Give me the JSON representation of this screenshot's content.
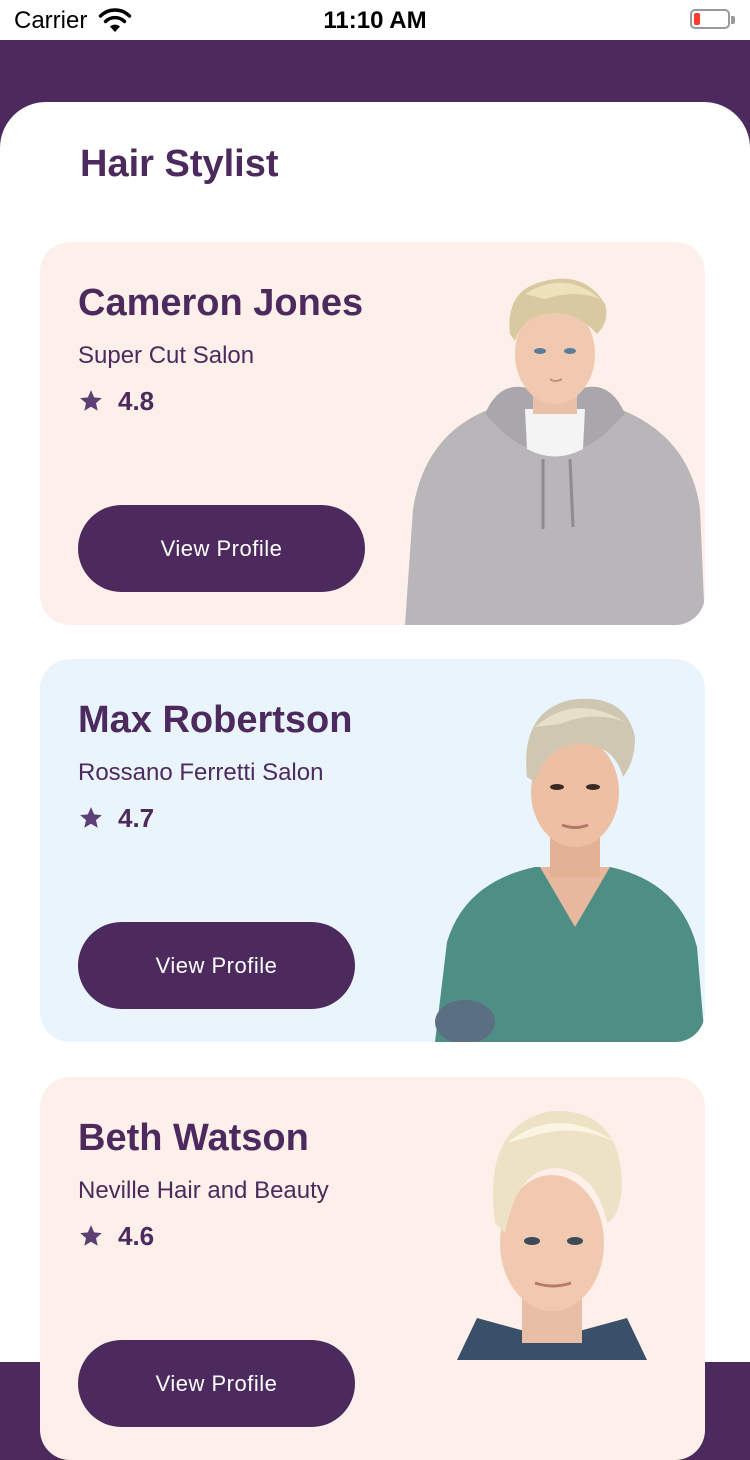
{
  "status_bar": {
    "carrier": "Carrier",
    "time": "11:10 AM",
    "wifi_icon": "wifi-icon",
    "battery_icon": "battery-low-icon"
  },
  "colors": {
    "primary": "#4c2a5e",
    "card_pink": "#fdefe9",
    "card_blue": "#eaf4fd",
    "rating_star": "#5c3f74"
  },
  "page": {
    "title": "Hair Stylist"
  },
  "stylists": [
    {
      "name": "Cameron Jones",
      "salon": "Super Cut Salon",
      "rating": "4.8",
      "button_label": "View Profile",
      "photo": "portrait-man-grey-hoodie"
    },
    {
      "name": "Max Robertson",
      "salon": "Rossano Ferretti Salon",
      "rating": "4.7",
      "button_label": "View Profile",
      "photo": "portrait-man-green-tshirt"
    },
    {
      "name": "Beth Watson",
      "salon": "Neville Hair and Beauty",
      "rating": "4.6",
      "button_label": "View Profile",
      "photo": "portrait-man-blond-denim"
    }
  ]
}
